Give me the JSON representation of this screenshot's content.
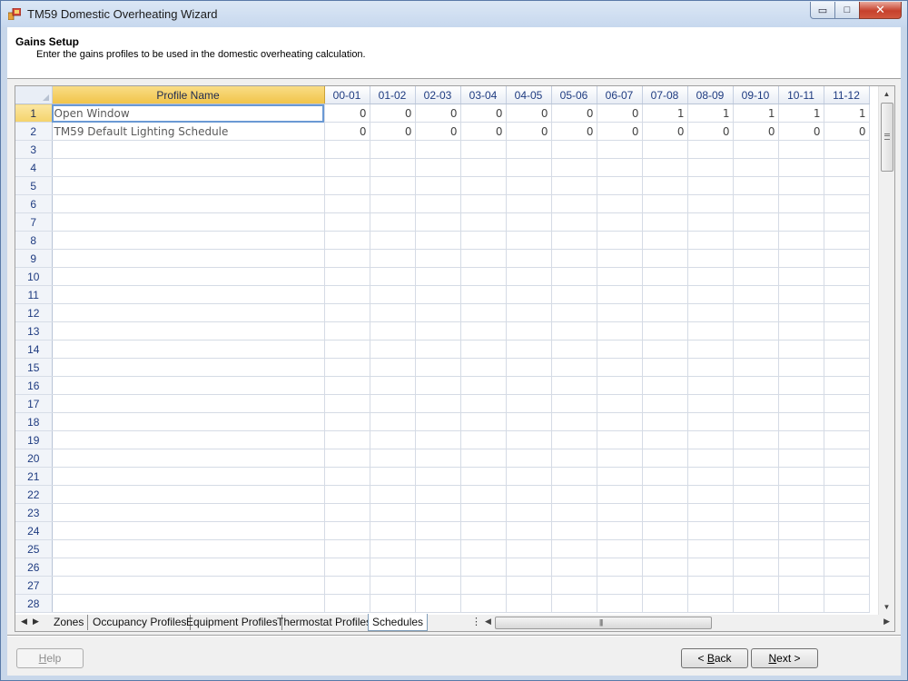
{
  "window": {
    "title": "TM59 Domestic Overheating Wizard",
    "min_glyph": "▭",
    "max_glyph": "□",
    "close_glyph": "✕"
  },
  "header": {
    "title": "Gains Setup",
    "subtitle": "Enter the gains profiles to be used in the domestic overheating calculation."
  },
  "grid": {
    "profile_column": "Profile Name",
    "hour_columns": [
      "00-01",
      "01-02",
      "02-03",
      "03-04",
      "04-05",
      "05-06",
      "06-07",
      "07-08",
      "08-09",
      "09-10",
      "10-11",
      "11-12"
    ],
    "row_numbers": [
      "1",
      "2",
      "3",
      "4",
      "5",
      "6",
      "7",
      "8",
      "9",
      "10",
      "11",
      "12",
      "13",
      "14",
      "15",
      "16",
      "17",
      "18",
      "19",
      "20",
      "21",
      "22",
      "23",
      "24",
      "25",
      "26",
      "27",
      "28"
    ],
    "rows": [
      {
        "name": "Open Window",
        "values": [
          "0",
          "0",
          "0",
          "0",
          "0",
          "0",
          "0",
          "1",
          "1",
          "1",
          "1",
          "1"
        ]
      },
      {
        "name": "TM59 Default Lighting Schedule",
        "values": [
          "0",
          "0",
          "0",
          "0",
          "0",
          "0",
          "0",
          "0",
          "0",
          "0",
          "0",
          "0"
        ]
      }
    ]
  },
  "tabs": {
    "items": [
      "Zones",
      "Occupancy Profiles",
      "Equipment Profiles",
      "Thermostat Profiles",
      "Schedules"
    ],
    "active": "Schedules"
  },
  "buttons": {
    "help_mnemonic": "H",
    "help_rest": "elp",
    "back_prefix": "< ",
    "back_mnemonic": "B",
    "back_rest": "ack",
    "next_mnemonic": "N",
    "next_rest": "ext >"
  },
  "colors": {
    "accent_header": "#f1c44a",
    "title_bar": "#c7d8ee",
    "close_button": "#c6412c"
  }
}
